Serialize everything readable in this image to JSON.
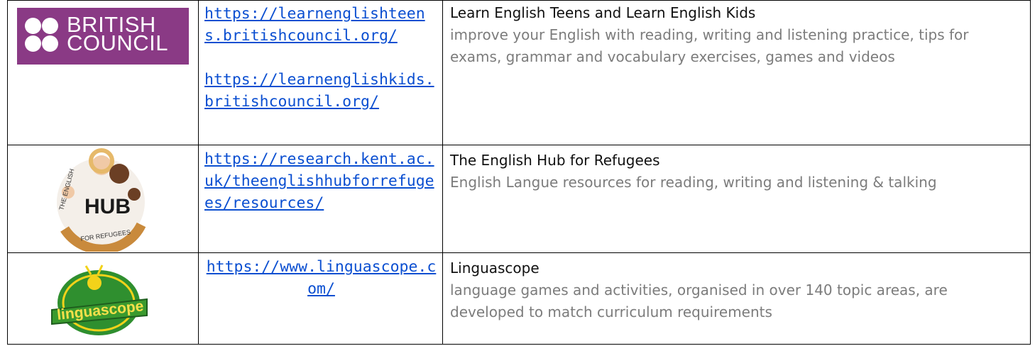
{
  "rows": [
    {
      "logo": {
        "name": "british-council-logo",
        "text_line1": "BRITISH",
        "text_line2": "COUNCIL"
      },
      "links": [
        "https://learnenglishteens.britishcouncil.org/",
        "https://learnenglishkids.britishcouncil.org/"
      ],
      "title": "Learn English Teens and Learn English Kids",
      "description": "improve your English with reading, writing and listening practice, tips for exams, grammar and vocabulary exercises, games and videos"
    },
    {
      "logo": {
        "name": "english-hub-logo",
        "word": "HUB",
        "arc_top": "THE ENGLISH",
        "arc_bottom": "FOR REFUGEES"
      },
      "links": [
        "https://research.kent.ac.uk/theenglishhubforrefugees/resources/"
      ],
      "title": "The English Hub for Refugees",
      "description": "English Langue resources for reading, writing and listening & talking"
    },
    {
      "logo": {
        "name": "linguascope-logo",
        "word": "linguascope"
      },
      "links": [
        "https://www.linguascope.com/"
      ],
      "title": "Linguascope",
      "description": "language games and activities, organised in over 140 topic areas, are developed to match curriculum requirements"
    }
  ],
  "colors": {
    "link": "#0b4fd1",
    "description": "#7c7c7c",
    "british_council_purple": "#8a3a85",
    "linguascope_green": "#2f8f2f"
  }
}
